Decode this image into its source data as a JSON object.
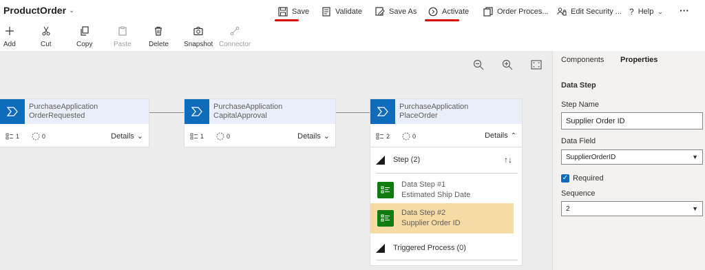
{
  "app": {
    "title": "ProductOrder"
  },
  "commands": {
    "save": "Save",
    "validate": "Validate",
    "save_as": "Save As",
    "activate": "Activate",
    "order_process": "Order Proces...",
    "edit_security": "Edit Security ...",
    "help": "Help",
    "more": "···"
  },
  "ribbon": {
    "add": "Add",
    "cut": "Cut",
    "copy": "Copy",
    "paste": "Paste",
    "delete": "Delete",
    "snapshot": "Snapshot",
    "connector": "Connector"
  },
  "stages": [
    {
      "line1": "PurchaseApplication",
      "line2": "OrderRequested",
      "steps": "1",
      "conditions": "0",
      "details": "Details"
    },
    {
      "line1": "PurchaseApplication",
      "line2": "CapitalApproval",
      "steps": "1",
      "conditions": "0",
      "details": "Details"
    },
    {
      "line1": "PurchaseApplication",
      "line2": "PlaceOrder",
      "steps": "2",
      "conditions": "0",
      "details": "Details"
    }
  ],
  "expanded": {
    "step_header": "Step (2)",
    "sort_arrows": "↑↓",
    "data_steps": [
      {
        "title": "Data Step #1",
        "subtitle": "Estimated Ship Date"
      },
      {
        "title": "Data Step #2",
        "subtitle": "Supplier Order ID"
      }
    ],
    "triggered": "Triggered Process (0)"
  },
  "panel": {
    "tab_components": "Components",
    "tab_properties": "Properties",
    "section": "Data Step",
    "step_name_label": "Step Name",
    "step_name_value": "Supplier Order ID",
    "data_field_label": "Data Field",
    "data_field_value": "SupplierOrderID",
    "required_label": "Required",
    "sequence_label": "Sequence",
    "sequence_value": "2"
  },
  "colors": {
    "stage_blue": "#0f6cbd",
    "data_step_green": "#107c10",
    "selected_row": "#f6dba4",
    "annotation_red": "#dd0000"
  }
}
